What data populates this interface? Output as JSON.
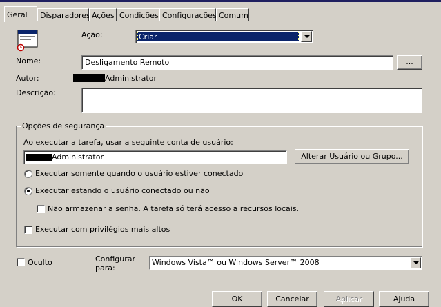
{
  "tabs": [
    {
      "label": "Geral"
    },
    {
      "label": "Disparadores"
    },
    {
      "label": "Ações"
    },
    {
      "label": "Condições"
    },
    {
      "label": "Configurações"
    },
    {
      "label": "Comum"
    }
  ],
  "general": {
    "action_label": "Ação:",
    "action_value": "Criar",
    "name_label": "Nome:",
    "name_value": "Desligamento Remoto",
    "browse_label": "...",
    "author_label": "Autor:",
    "author_value": "Administrator",
    "description_label": "Descrição:",
    "description_value": ""
  },
  "security": {
    "legend": "Opções de segurança",
    "run_as_text": "Ao executar a tarefa, usar a seguinte conta de usuário:",
    "account_value": "Administrator",
    "change_user_button": "Alterar Usuário ou Grupo...",
    "radio_logged_on": "Executar somente quando o usuário estiver conectado",
    "radio_logged_on_or_not": "Executar estando o usuário conectado ou não",
    "selected_radio": "radio_logged_on_or_not",
    "no_store_password": "Não armazenar a senha. A tarefa só terá acesso a recursos locais.",
    "run_highest": "Executar com privilégios mais altos"
  },
  "footer": {
    "hidden_label": "Oculto",
    "configure_label_1": "Configurar",
    "configure_label_2": "para:",
    "configure_value": "Windows Vista™ ou Windows Server™ 2008"
  },
  "buttons": {
    "ok": "OK",
    "cancel": "Cancelar",
    "apply": "Aplicar",
    "help": "Ajuda"
  },
  "colors": {
    "face": "#d4d0c8",
    "selection": "#0a246a",
    "title_bar": "#1f1f60"
  }
}
